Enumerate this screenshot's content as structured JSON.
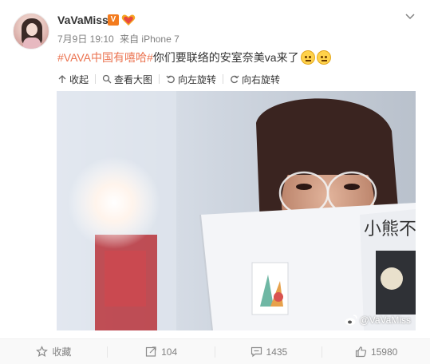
{
  "post": {
    "author": "VaVaMiss",
    "verified_badge": "V",
    "date": "7月9日 19:10",
    "source": "来自 iPhone 7",
    "topic": "#VAVA中国有嘻哈#",
    "text": "你们要联络的安室奈美va来了"
  },
  "toolbar": {
    "collapse": "收起",
    "view_large": "查看大图",
    "rotate_left": "向左旋转",
    "rotate_right": "向右旋转"
  },
  "photo": {
    "watermark": "@VaVaMiss",
    "book_text": "小熊不"
  },
  "footer": {
    "favorite": "收藏",
    "repost_count": "104",
    "comment_count": "1435",
    "like_count": "15980"
  },
  "colors": {
    "topic": "#eb7350",
    "badge": "#f37b1d",
    "meta": "#808080"
  },
  "icons": {
    "more": "chevron-down-icon",
    "collapse": "collapse-icon",
    "view_large": "magnifier-icon",
    "rotate_left": "rotate-left-icon",
    "rotate_right": "rotate-right-icon",
    "favorite": "star-icon",
    "repost": "repost-icon",
    "comment": "comment-icon",
    "like": "thumbs-up-icon",
    "watermark": "weibo-logo-icon"
  }
}
